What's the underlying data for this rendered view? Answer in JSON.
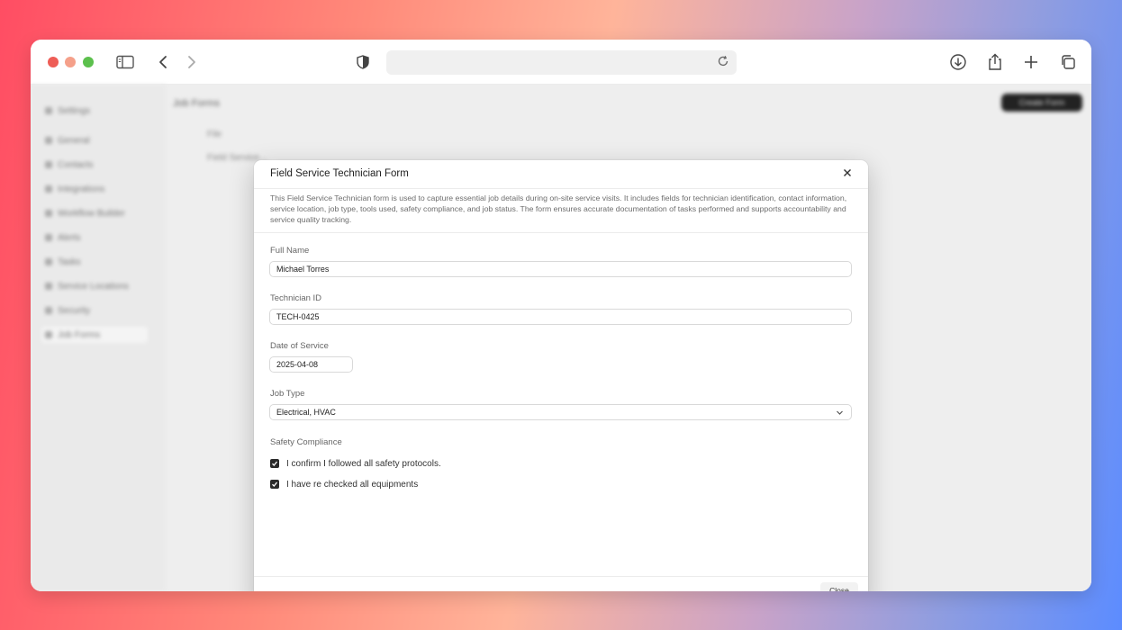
{
  "browser": {
    "url": ""
  },
  "background_app": {
    "page_title": "Job Forms",
    "rows": [
      "File",
      "Field Service..."
    ],
    "sidebar_items": [
      {
        "label": "Settings"
      },
      {
        "label": "General"
      },
      {
        "label": "Contacts"
      },
      {
        "label": "Integrations"
      },
      {
        "label": "Workflow Builder"
      },
      {
        "label": "Alerts"
      },
      {
        "label": "Tasks"
      },
      {
        "label": "Service Locations"
      },
      {
        "label": "Security"
      },
      {
        "label": "Job Forms",
        "active": true
      }
    ],
    "action_button": "Create Form"
  },
  "modal": {
    "title": "Field Service Technician Form",
    "description": "This Field Service Technician form is used to capture essential job details during on-site service visits. It includes fields for technician identification, contact information, service location, job type, tools used, safety compliance, and job status. The form ensures accurate documentation of tasks performed and supports accountability and service quality tracking.",
    "fields": {
      "full_name": {
        "label": "Full Name",
        "value": "Michael Torres"
      },
      "technician_id": {
        "label": "Technician ID",
        "value": "TECH-0425"
      },
      "date_of_service": {
        "label": "Date of Service",
        "value": "2025-04-08"
      },
      "job_type": {
        "label": "Job Type",
        "value": "Electrical, HVAC"
      }
    },
    "safety": {
      "label": "Safety Compliance",
      "items": [
        {
          "label": "I confirm I followed all safety protocols.",
          "checked": true
        },
        {
          "label": "I have re checked all equipments",
          "checked": true
        }
      ]
    },
    "close_button": "Close"
  }
}
